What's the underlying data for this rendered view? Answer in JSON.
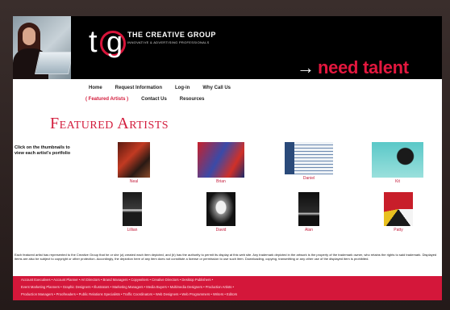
{
  "header": {
    "brand": "THE CREATIVE GROUP",
    "tagline": "INNOVATIVE & ADVERTISING PROFESSIONALS",
    "cta_arrow": "→",
    "cta": "need talent"
  },
  "nav": {
    "row1": [
      "Home",
      "Request Information",
      "Log-in",
      "Why Call Us"
    ],
    "row2": [
      "( Featured Artists )",
      "Contact Us",
      "Resources"
    ]
  },
  "page_title": "Featured Artists",
  "instructions": "Click on the thumbnails to view each artist's portfolio",
  "artists": [
    {
      "name": "Neal"
    },
    {
      "name": "Brian"
    },
    {
      "name": "Daniel"
    },
    {
      "name": "Kit"
    },
    {
      "name": "Lillian"
    },
    {
      "name": "David"
    },
    {
      "name": "Alan"
    },
    {
      "name": "Patty"
    }
  ],
  "disclaimer": "Each featured artist has represented to the Creative Group that he or she (a) created each item depicted, and (b) has the authority to permit its display at this web site. Any trademark depicted in the artwork is the property of the trademark owner, who retains the rights to said trademark. Displayed items are also be subject to copyright or other protection. Accordingly, the depiction here of any item does not constitute a license or permission to use such item. Downloading, copying, transmitting or any other use of the displayed item is prohibited.",
  "footer": {
    "lines": [
      "Account Executives • Account Planner • Art Directors • Brand Managers • Copywriters • Creative Directors • Desktop Publishers •",
      "Event Marketing Planners • Graphic Designers • Illustrators • Marketing Managers • Media Buyers • Multimedia Designers • Production Artists •",
      "Production Managers • Proofreaders • Public Relations Specialists • Traffic Coordinators • Web Designers • Web Programmers • Writers • Editors"
    ]
  },
  "colors": {
    "accent": "#d31c3c",
    "header_bg": "#000000",
    "footer_bg": "#d4173a"
  }
}
